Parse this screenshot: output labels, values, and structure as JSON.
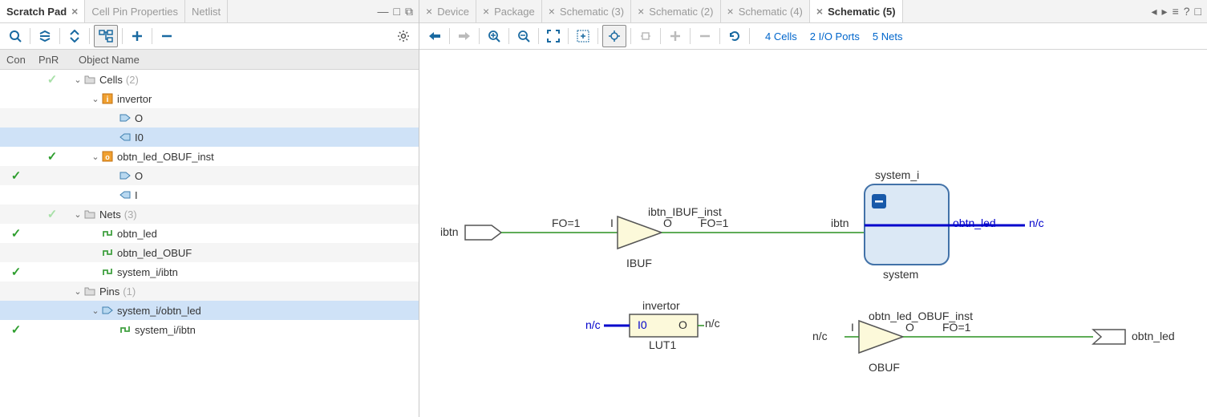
{
  "left": {
    "tabs": [
      {
        "label": "Scratch Pad",
        "active": true
      },
      {
        "label": "Cell Pin Properties",
        "active": false
      },
      {
        "label": "Netlist",
        "active": false
      }
    ],
    "cols": {
      "con": "Con",
      "pnr": "PnR",
      "obj": "Object Name"
    },
    "tree": [
      {
        "pnr": "light",
        "indent": 0,
        "exp": true,
        "kind": "folder",
        "label": "Cells",
        "count": "(2)"
      },
      {
        "indent": 1,
        "exp": true,
        "kind": "comp-i",
        "label": "invertor"
      },
      {
        "indent": 2,
        "kind": "pin-out",
        "label": "O",
        "light": true
      },
      {
        "indent": 2,
        "kind": "pin-in",
        "label": "I0",
        "sel": true
      },
      {
        "pnr": "dark",
        "indent": 1,
        "exp": true,
        "kind": "comp-o",
        "label": "obtn_led_OBUF_inst"
      },
      {
        "con": "dark",
        "indent": 2,
        "kind": "pin-out",
        "label": "O",
        "light": true
      },
      {
        "indent": 2,
        "kind": "pin-in",
        "label": "I"
      },
      {
        "pnr": "light",
        "indent": 0,
        "exp": true,
        "kind": "folder",
        "label": "Nets",
        "count": "(3)",
        "light": true
      },
      {
        "con": "dark",
        "indent": 1,
        "kind": "net",
        "label": "obtn_led"
      },
      {
        "indent": 1,
        "kind": "net",
        "label": "obtn_led_OBUF",
        "light": true
      },
      {
        "con": "dark",
        "indent": 1,
        "kind": "net",
        "label": "system_i/ibtn"
      },
      {
        "indent": 0,
        "exp": true,
        "kind": "folder",
        "label": "Pins",
        "count": "(1)",
        "light": true
      },
      {
        "indent": 1,
        "exp": true,
        "kind": "pin-out",
        "label": "system_i/obtn_led",
        "sel": true
      },
      {
        "con": "dark",
        "indent": 2,
        "kind": "net",
        "label": "system_i/ibtn"
      }
    ]
  },
  "right": {
    "tabs": [
      {
        "label": "Device"
      },
      {
        "label": "Package"
      },
      {
        "label": "Schematic (3)"
      },
      {
        "label": "Schematic (2)"
      },
      {
        "label": "Schematic (4)"
      },
      {
        "label": "Schematic (5)",
        "active": true
      }
    ],
    "stats": {
      "cells": "4 Cells",
      "ports": "2 I/O Ports",
      "nets": "5 Nets"
    },
    "schem": {
      "ibtn_port": "ibtn",
      "fo1_a": "FO=1",
      "ibuf_name": "ibtn_IBUF_inst",
      "ibuf_type": "IBUF",
      "ibuf_i": "I",
      "ibuf_o": "O",
      "fo1_b": "FO=1",
      "ibtn_wire": "ibtn",
      "sys_i": "system_i",
      "sys": "system",
      "obtn_led_out": "obtn_led",
      "nc1": "n/c",
      "nc2": "n/c",
      "nc3": "n/c",
      "nc4": "n/c",
      "inv_name": "invertor",
      "inv_type": "LUT1",
      "inv_i0": "I0",
      "inv_o": "O",
      "obuf_name": "obtn_led_OBUF_inst",
      "obuf_type": "OBUF",
      "obuf_i": "I",
      "obuf_o": "O",
      "fo1_c": "FO=1",
      "obtn_led_port": "obtn_led"
    }
  }
}
